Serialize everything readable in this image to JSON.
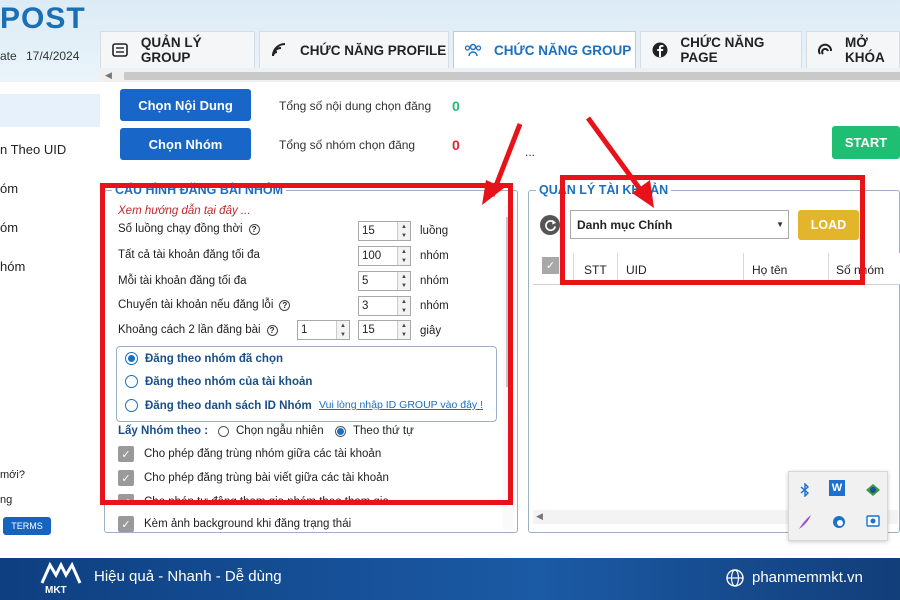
{
  "app": {
    "logo": "POST",
    "date_label": "ate",
    "date_value": "17/4/2024"
  },
  "tabs": [
    {
      "label": "QUẢN LÝ GROUP",
      "icon": "list-icon"
    },
    {
      "label": "CHỨC NĂNG PROFILE",
      "icon": "rss-icon"
    },
    {
      "label": "CHỨC NĂNG GROUP",
      "icon": "group-icon",
      "active": true
    },
    {
      "label": "CHỨC NĂNG PAGE",
      "icon": "facebook-icon"
    },
    {
      "label": "MỞ KHÓA",
      "icon": "unlock-icon"
    }
  ],
  "sidebar": {
    "items": [
      "n Theo UID",
      "óm",
      "óm",
      "hóm"
    ],
    "bottom_items": [
      "mới?",
      "ng"
    ],
    "terms": "TERMS"
  },
  "actions": {
    "chon_noi_dung": "Chọn Nội Dung",
    "chon_nhom": "Chọn Nhóm",
    "noi_dung_label": "Tổng số nội dung chọn đăng",
    "noi_dung_count": "0",
    "nhom_label": "Tổng số nhóm chọn đăng",
    "nhom_count": "0",
    "ellipsis": "...",
    "start": "START"
  },
  "config": {
    "title": "CẤU HÌNH ĐĂNG BÀI NHÓM",
    "guide": "Xem hướng dẫn tại đây ...",
    "rows": [
      {
        "label": "Số luồng chạy đồng thời",
        "value": "15",
        "unit": "luồng"
      },
      {
        "label": "Tất cả tài khoản đăng tối đa",
        "value": "100",
        "unit": "nhóm"
      },
      {
        "label": "Mỗi tài khoản đăng tối đa",
        "value": "5",
        "unit": "nhóm"
      },
      {
        "label": "Chuyển tài khoản nếu đăng lỗi",
        "value": "3",
        "unit": "nhóm"
      },
      {
        "label": "Khoảng cách 2 lần đăng bài",
        "value_from": "1",
        "value_to": "15",
        "unit": "giây"
      }
    ],
    "radios": [
      {
        "label": "Đăng theo nhóm đã chọn",
        "selected": true
      },
      {
        "label": "Đăng theo nhóm của tài khoản",
        "selected": false
      },
      {
        "label": "Đăng theo danh sách ID Nhóm",
        "selected": false
      }
    ],
    "id_group_link": "Vui lòng nhập ID GROUP vào đây !",
    "lay_nhom_label": "Lấy Nhóm theo :",
    "lay_nhom_options": [
      {
        "label": "Chọn ngẫu nhiên",
        "selected": false
      },
      {
        "label": "Theo thứ tự",
        "selected": true
      }
    ],
    "checks": [
      "Cho phép đăng trùng nhóm giữa các tài khoản",
      "Cho phép đăng trùng bài viết giữa các tài khoản",
      "Cho phép tự động tham gia nhóm theo tham gia",
      "Kèm ảnh background khi đăng trạng thái"
    ]
  },
  "accounts": {
    "title": "QUẢN LÝ TÀI KHOẢN",
    "category": "Danh mục Chính",
    "load": "LOAD",
    "columns": [
      "STT",
      "UID",
      "Họ tên",
      "Số nhóm"
    ]
  },
  "footer": {
    "brand": "MKT",
    "tagline": "Hiệu quả - Nhanh - Dễ dùng",
    "website": "phanmemmkt.vn"
  },
  "colors": {
    "primary": "#1866c8",
    "start": "#1fbf73",
    "load": "#e2b52a",
    "annotation": "#e8121b",
    "count_green": "#1fbf73",
    "count_red": "#e0262b"
  }
}
